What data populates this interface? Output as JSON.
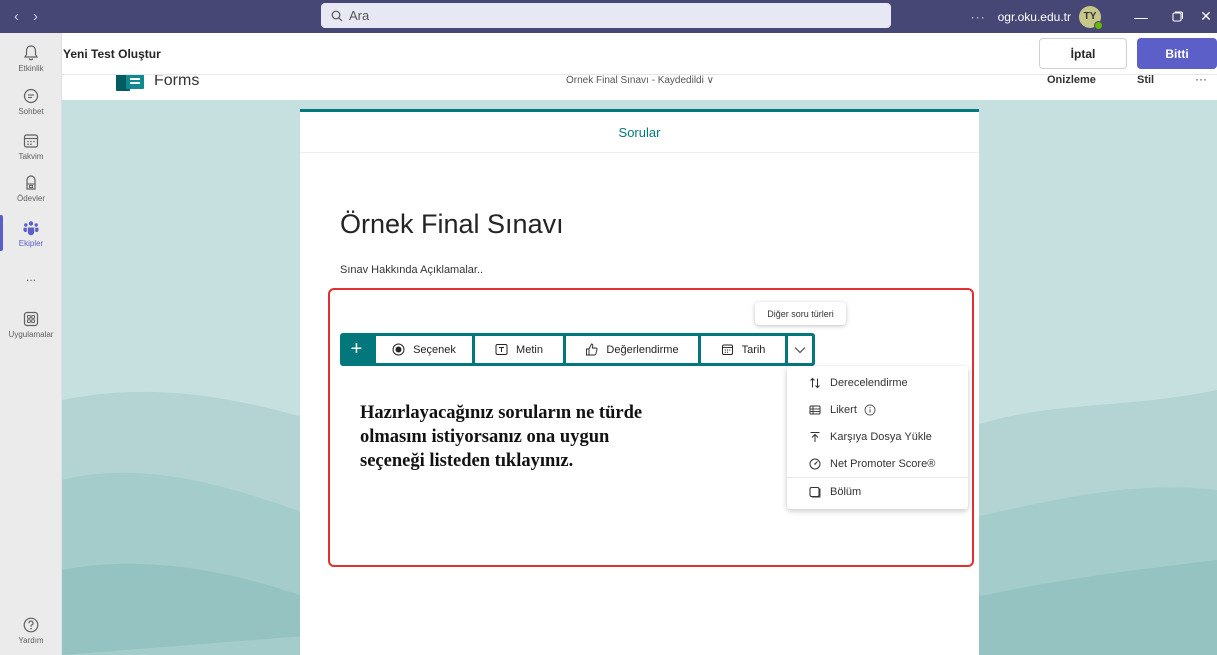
{
  "titlebar": {
    "search_placeholder": "Ara",
    "more": "···",
    "org": "ogr.oku.edu.tr",
    "avatar_initials": "TY"
  },
  "rail": {
    "items": [
      {
        "label": "Etkinlik",
        "icon": "bell-icon"
      },
      {
        "label": "Sohbet",
        "icon": "chat-icon"
      },
      {
        "label": "Takvim",
        "icon": "calendar-icon"
      },
      {
        "label": "Ödevler",
        "icon": "assignments-icon"
      },
      {
        "label": "Ekipler",
        "icon": "teams-icon"
      },
      {
        "label": "...",
        "icon": "more-icon"
      },
      {
        "label": "Uygulamalar",
        "icon": "apps-icon"
      },
      {
        "label": "Yardım",
        "icon": "help-icon"
      }
    ]
  },
  "header": {
    "title": "Yeni Test Oluştur",
    "cancel_label": "İptal",
    "done_label": "Bitti"
  },
  "forms_header": {
    "app_name": "Forms",
    "doc_title": "Örnek Final Sınavı  -  Kaydedildi  ∨",
    "preview_label": "Önizleme",
    "style_label": "Stil",
    "more": "···"
  },
  "form": {
    "tab_label": "Sorular",
    "title": "Örnek Final Sınavı",
    "description": "Sınav Hakkında Açıklamalar.."
  },
  "toolbar": {
    "add": "+",
    "choice_label": "Seçenek",
    "text_label": "Metin",
    "rating_label": "Değerlendirme",
    "date_label": "Tarih",
    "tooltip": "Diğer soru türleri"
  },
  "menu": {
    "items": [
      {
        "label": "Derecelendirme",
        "icon": "ranking-icon"
      },
      {
        "label": "Likert",
        "icon": "likert-icon"
      },
      {
        "label": "Karşıya Dosya Yükle",
        "icon": "upload-icon"
      },
      {
        "label": "Net Promoter Score®",
        "icon": "gauge-icon"
      },
      {
        "label": "Bölüm",
        "icon": "section-icon"
      }
    ]
  },
  "instruction": {
    "line1": "Hazırlayacağınız soruların ne türde",
    "line2": "olmasını istiyorsanız ona uygun",
    "line3": "seçeneği listeden tıklayınız."
  },
  "colors": {
    "teams_purple": "#464775",
    "accent": "#5b5fc7",
    "forms_teal": "#03787c",
    "annotation_red": "#e03030"
  }
}
